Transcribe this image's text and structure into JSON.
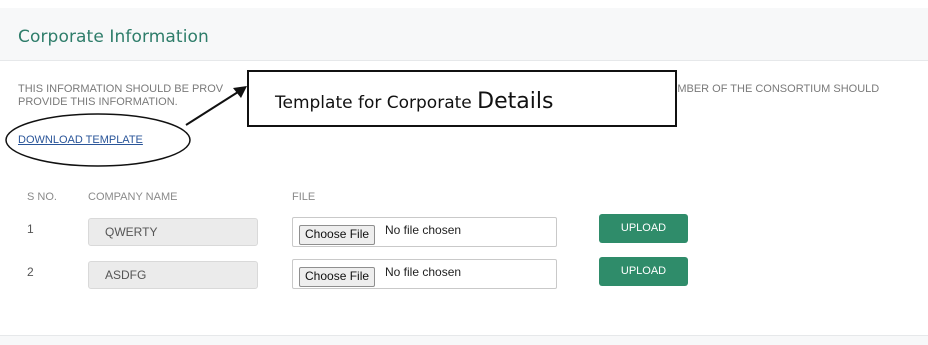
{
  "panel": {
    "title": "Corporate Information"
  },
  "notice": {
    "line1_left": "THIS INFORMATION SHOULD BE PROV",
    "line1_right": "EMBER OF THE CONSORTIUM SHOULD",
    "line2": "PROVIDE THIS INFORMATION."
  },
  "download": {
    "label": "DOWNLOAD TEMPLATE"
  },
  "callout": {
    "text_prefix": "Template for Corporate ",
    "text_emphasis": "Details"
  },
  "table": {
    "headers": {
      "sno": "S NO.",
      "company": "COMPANY NAME",
      "file": "FILE"
    },
    "rows": [
      {
        "sno": "1",
        "company": "QWERTY",
        "choose_label": "Choose File",
        "file_status": "No file chosen",
        "upload_label": "UPLOAD"
      },
      {
        "sno": "2",
        "company": "ASDFG",
        "choose_label": "Choose File",
        "file_status": "No file chosen",
        "upload_label": "UPLOAD"
      }
    ]
  },
  "colors": {
    "title_teal": "#2e7d6a",
    "upload_green": "#2f8c6a",
    "link_blue": "#2a5599"
  }
}
